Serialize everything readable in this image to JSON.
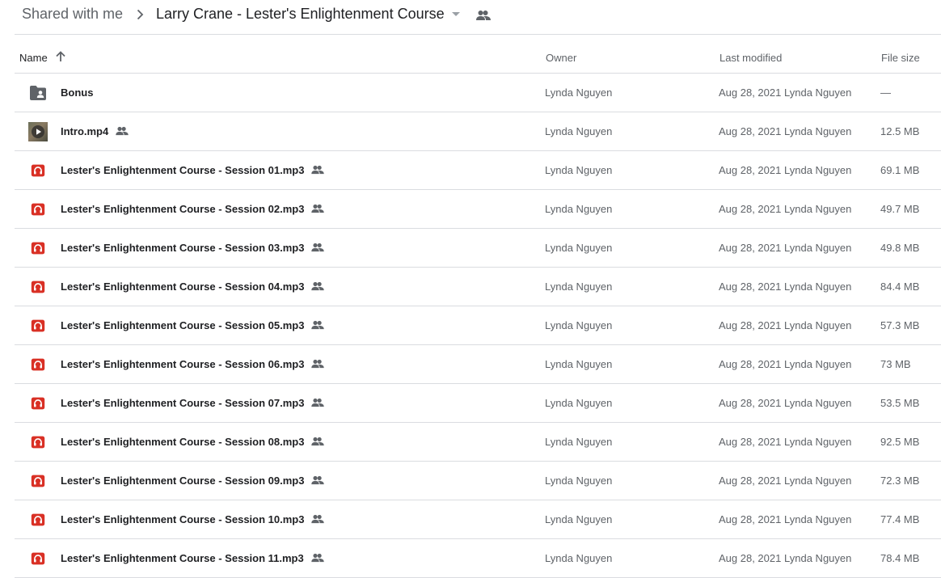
{
  "breadcrumb": {
    "root": "Shared with me",
    "current": "Larry Crane - Lester's Enlightenment Course"
  },
  "columns": {
    "name": "Name",
    "owner": "Owner",
    "last_modified": "Last modified",
    "file_size": "File size"
  },
  "files": [
    {
      "name": "Bonus",
      "type": "shared-folder",
      "shared": false,
      "owner": "Lynda Nguyen",
      "modified_date": "Aug 28, 2021",
      "modified_by": "Lynda Nguyen",
      "size": "—"
    },
    {
      "name": "Intro.mp4",
      "type": "video",
      "shared": true,
      "owner": "Lynda Nguyen",
      "modified_date": "Aug 28, 2021",
      "modified_by": "Lynda Nguyen",
      "size": "12.5 MB"
    },
    {
      "name": "Lester's Enlightenment Course - Session 01.mp3",
      "type": "audio",
      "shared": true,
      "owner": "Lynda Nguyen",
      "modified_date": "Aug 28, 2021",
      "modified_by": "Lynda Nguyen",
      "size": "69.1 MB"
    },
    {
      "name": "Lester's Enlightenment Course - Session 02.mp3",
      "type": "audio",
      "shared": true,
      "owner": "Lynda Nguyen",
      "modified_date": "Aug 28, 2021",
      "modified_by": "Lynda Nguyen",
      "size": "49.7 MB"
    },
    {
      "name": "Lester's Enlightenment Course - Session 03.mp3",
      "type": "audio",
      "shared": true,
      "owner": "Lynda Nguyen",
      "modified_date": "Aug 28, 2021",
      "modified_by": "Lynda Nguyen",
      "size": "49.8 MB"
    },
    {
      "name": "Lester's Enlightenment Course - Session 04.mp3",
      "type": "audio",
      "shared": true,
      "owner": "Lynda Nguyen",
      "modified_date": "Aug 28, 2021",
      "modified_by": "Lynda Nguyen",
      "size": "84.4 MB"
    },
    {
      "name": "Lester's Enlightenment Course - Session 05.mp3",
      "type": "audio",
      "shared": true,
      "owner": "Lynda Nguyen",
      "modified_date": "Aug 28, 2021",
      "modified_by": "Lynda Nguyen",
      "size": "57.3 MB"
    },
    {
      "name": "Lester's Enlightenment Course - Session 06.mp3",
      "type": "audio",
      "shared": true,
      "owner": "Lynda Nguyen",
      "modified_date": "Aug 28, 2021",
      "modified_by": "Lynda Nguyen",
      "size": "73 MB"
    },
    {
      "name": "Lester's Enlightenment Course - Session 07.mp3",
      "type": "audio",
      "shared": true,
      "owner": "Lynda Nguyen",
      "modified_date": "Aug 28, 2021",
      "modified_by": "Lynda Nguyen",
      "size": "53.5 MB"
    },
    {
      "name": "Lester's Enlightenment Course - Session 08.mp3",
      "type": "audio",
      "shared": true,
      "owner": "Lynda Nguyen",
      "modified_date": "Aug 28, 2021",
      "modified_by": "Lynda Nguyen",
      "size": "92.5 MB"
    },
    {
      "name": "Lester's Enlightenment Course - Session 09.mp3",
      "type": "audio",
      "shared": true,
      "owner": "Lynda Nguyen",
      "modified_date": "Aug 28, 2021",
      "modified_by": "Lynda Nguyen",
      "size": "72.3 MB"
    },
    {
      "name": "Lester's Enlightenment Course - Session 10.mp3",
      "type": "audio",
      "shared": true,
      "owner": "Lynda Nguyen",
      "modified_date": "Aug 28, 2021",
      "modified_by": "Lynda Nguyen",
      "size": "77.4 MB"
    },
    {
      "name": "Lester's Enlightenment Course - Session 11.mp3",
      "type": "audio",
      "shared": true,
      "owner": "Lynda Nguyen",
      "modified_date": "Aug 28, 2021",
      "modified_by": "Lynda Nguyen",
      "size": "78.4 MB"
    }
  ],
  "icons": {
    "breadcrumb_separator": "chevron-right-icon",
    "breadcrumb_menu": "caret-down-icon",
    "breadcrumb_shared": "people-icon",
    "sort": "arrow-up-icon",
    "folder": "shared-folder-icon",
    "audio": "audio-file-icon",
    "video": "video-thumbnail-icon",
    "shared": "people-icon"
  },
  "colors": {
    "audio_icon": "#d93025",
    "folder_icon": "#5f6368",
    "divider": "#dadce0",
    "muted_text": "#5f6368",
    "primary_text": "#202124"
  }
}
